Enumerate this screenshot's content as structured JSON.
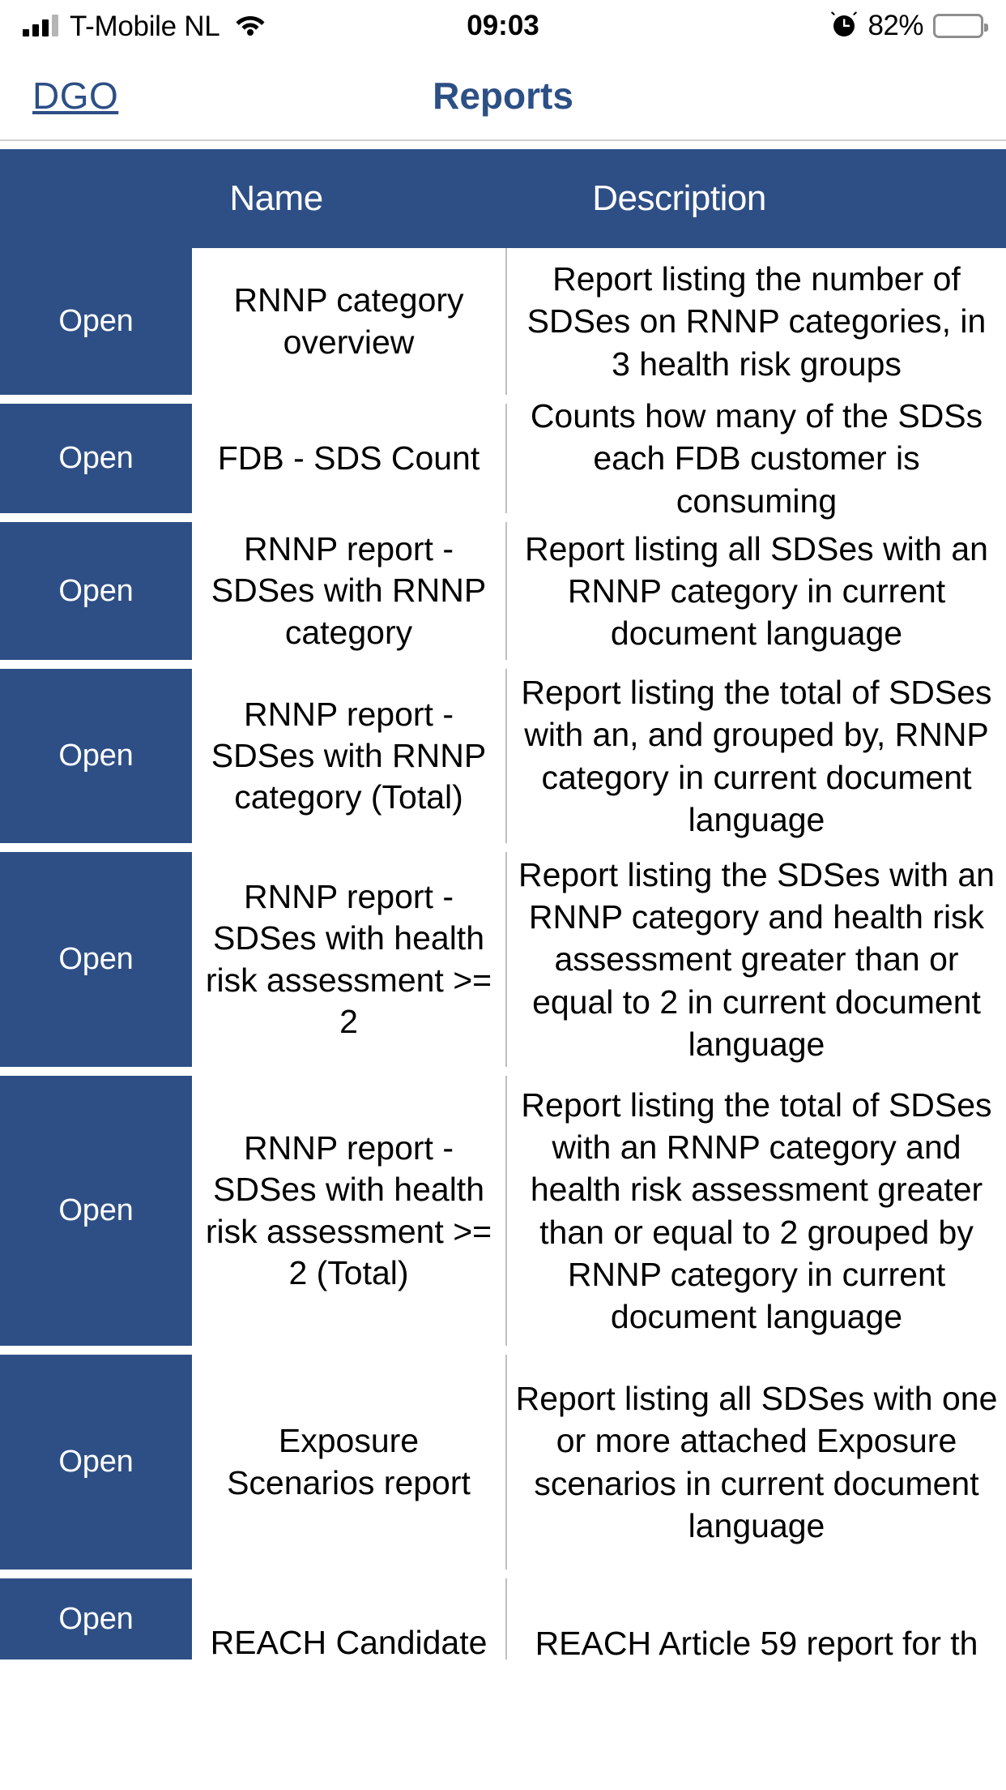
{
  "status_bar": {
    "carrier": "T-Mobile NL",
    "time": "09:03",
    "battery_percent": "82%",
    "battery_level": 82,
    "signal_bars_filled": 3,
    "signal_bars_total": 4,
    "wifi_icon": "wifi-icon",
    "alarm_icon": "alarm-clock-icon"
  },
  "nav_bar": {
    "back_label": "DGO",
    "title": "Reports"
  },
  "colors": {
    "brand_blue": "#2e4f86",
    "nav_text_blue": "#2c4f85",
    "divider_gray": "#bfbfbf",
    "page_background": "#ffffff"
  },
  "table": {
    "columns": {
      "action": "",
      "name": "Name",
      "description": "Description"
    },
    "open_button_label": "Open",
    "rows": [
      {
        "action": "Open",
        "name": "RNNP category overview",
        "description": "Report listing the number of SDSes on RNNP categories, in 3 health risk groups"
      },
      {
        "action": "Open",
        "name": "FDB - SDS Count",
        "description": "Counts how many of the SDSs each FDB customer is consuming"
      },
      {
        "action": "Open",
        "name": "RNNP report - SDSes with RNNP category",
        "description": "Report listing all SDSes with an RNNP category in current document language"
      },
      {
        "action": "Open",
        "name": "RNNP report - SDSes with RNNP category (Total)",
        "description": "Report listing the total of SDSes with an, and grouped by, RNNP category in current document language"
      },
      {
        "action": "Open",
        "name": "RNNP report - SDSes with health risk assessment >= 2",
        "description": "Report listing the SDSes with an RNNP category and health risk assessment greater than or equal to 2 in current document language"
      },
      {
        "action": "Open",
        "name": "RNNP report - SDSes with health risk assessment >= 2 (Total)",
        "description": "Report listing the total of SDSes with an RNNP category and health risk assessment greater than or equal to 2 grouped by RNNP category in current document language"
      },
      {
        "action": "Open",
        "name": "Exposure Scenarios report",
        "description": "Report listing all SDSes with one or more attached Exposure scenarios in current document language"
      },
      {
        "action": "Open",
        "name": "REACH Candidate",
        "description": "REACH Article 59 report for th"
      }
    ]
  }
}
